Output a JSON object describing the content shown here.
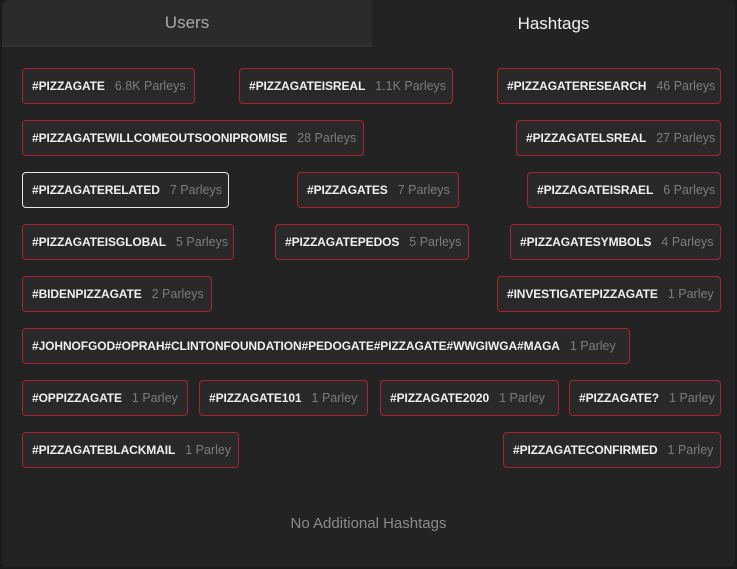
{
  "tabs": {
    "users": "Users",
    "hashtags": "Hashtags"
  },
  "hashtags": [
    {
      "name": "#PIZZAGATE",
      "count": "6.8K Parleys"
    },
    {
      "name": "#PIZZAGATEISREAL",
      "count": "1.1K Parleys"
    },
    {
      "name": "#PIZZAGATERESEARCH",
      "count": "46 Parleys"
    },
    {
      "name": "#PIZZAGATEWILLCOMEOUTSOONIPROMISE",
      "count": "28 Parleys"
    },
    {
      "name": "#PIZZAGATELSREAL",
      "count": "27 Parleys"
    },
    {
      "name": "#PIZZAGATERELATED",
      "count": "7 Parleys"
    },
    {
      "name": "#PIZZAGATES",
      "count": "7 Parleys"
    },
    {
      "name": "#PIZZAGATEISRAEL",
      "count": "6 Parleys"
    },
    {
      "name": "#PIZZAGATEISGLOBAL",
      "count": "5 Parleys"
    },
    {
      "name": "#PIZZAGATEPEDOS",
      "count": "5 Parleys"
    },
    {
      "name": "#PIZZAGATESYMBOLS",
      "count": "4 Parleys"
    },
    {
      "name": "#BIDENPIZZAGATE",
      "count": "2 Parleys"
    },
    {
      "name": "#INVESTIGATEPIZZAGATE",
      "count": "1 Parley"
    },
    {
      "name": "#JOHNOFGOD#OPRAH#CLINTONFOUNDATION#PEDOGATE#PIZZAGATE#WWGIWGA#MAGA",
      "count": "1 Parley"
    },
    {
      "name": "#OPPIZZAGATE",
      "count": "1 Parley"
    },
    {
      "name": "#PIZZAGATE101",
      "count": "1 Parley"
    },
    {
      "name": "#PIZZAGATE2020",
      "count": "1 Parley"
    },
    {
      "name": "#PIZZAGATE?",
      "count": "1 Parley"
    },
    {
      "name": "#PIZZAGATEBLACKMAIL",
      "count": "1 Parley"
    },
    {
      "name": "#PIZZAGATECONFIRMED",
      "count": "1 Parley"
    }
  ],
  "footer": "No Additional Hashtags"
}
